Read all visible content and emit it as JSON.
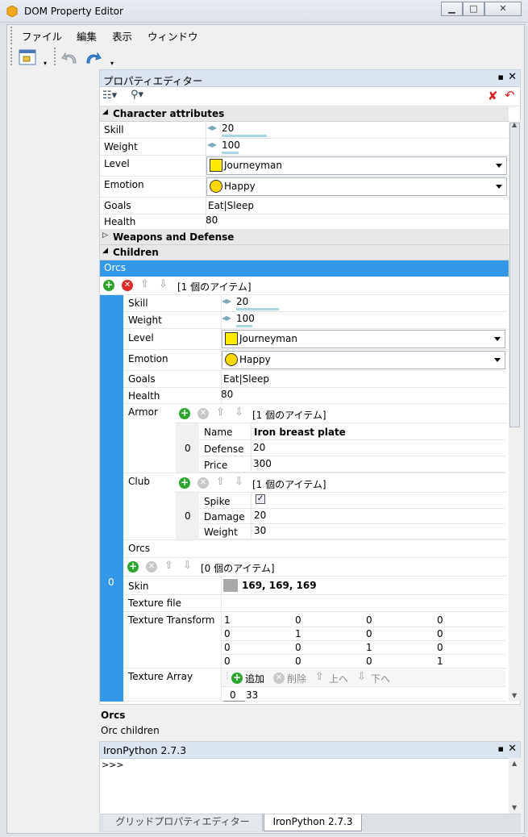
{
  "window": {
    "title": "DOM Property Editor",
    "minimize": "▁",
    "maximize": "□",
    "close": "✕"
  },
  "menu": [
    "ファイル",
    "編集",
    "表示",
    "ウィンドウ"
  ],
  "property_panel": {
    "title": "プロパティエディター",
    "pin_glyph": "📌",
    "close_glyph": "✕",
    "categories": {
      "character": "Character attributes",
      "weapons": "Weapons and Defense",
      "children": "Children"
    },
    "character": {
      "skill": {
        "label": "Skill",
        "value": "20"
      },
      "weight": {
        "label": "Weight",
        "value": "100"
      },
      "level": {
        "label": "Level",
        "value": "Journeyman"
      },
      "emotion": {
        "label": "Emotion",
        "value": "Happy"
      },
      "goals": {
        "label": "Goals",
        "value": "Eat|Sleep"
      },
      "health": {
        "label": "Health",
        "value": "80"
      }
    },
    "orcs_header": "Orcs",
    "orcs_count": "[1 個のアイテム]",
    "orc_index": "0",
    "orc": {
      "skill": {
        "label": "Skill",
        "value": "20"
      },
      "weight": {
        "label": "Weight",
        "value": "100"
      },
      "level": {
        "label": "Level",
        "value": "Journeyman"
      },
      "emotion": {
        "label": "Emotion",
        "value": "Happy"
      },
      "goals": {
        "label": "Goals",
        "value": "Eat|Sleep"
      },
      "health": {
        "label": "Health",
        "value": "80"
      },
      "armor": {
        "label": "Armor",
        "count": "[1 個のアイテム]",
        "index": "0",
        "name": {
          "label": "Name",
          "value": "Iron breast plate"
        },
        "defense": {
          "label": "Defense",
          "value": "20"
        },
        "price": {
          "label": "Price",
          "value": "300"
        }
      },
      "club": {
        "label": "Club",
        "count": "[1 個のアイテム]",
        "index": "0",
        "spike": {
          "label": "Spike",
          "checked": true
        },
        "damage": {
          "label": "Damage",
          "value": "20"
        },
        "weight": {
          "label": "Weight",
          "value": "30"
        }
      },
      "orcs": {
        "label": "Orcs",
        "count": "[0 個のアイテム]"
      },
      "skin": {
        "label": "Skin",
        "value": "169, 169, 169",
        "color": "#a9a9a9"
      },
      "texture_file": {
        "label": "Texture file",
        "value": ""
      },
      "texture_transform": {
        "label": "Texture Transform",
        "matrix": [
          [
            "1",
            "0",
            "0",
            "0"
          ],
          [
            "0",
            "1",
            "0",
            "0"
          ],
          [
            "0",
            "0",
            "1",
            "0"
          ],
          [
            "0",
            "0",
            "0",
            "1"
          ]
        ]
      },
      "texture_array": {
        "label": "Texture Array",
        "add": "追加",
        "delete": "削除",
        "up": "上へ",
        "down": "下へ",
        "index": "0",
        "value": "33"
      }
    }
  },
  "description": {
    "title": "Orcs",
    "text": "Orc children"
  },
  "python": {
    "title": "IronPython 2.7.3",
    "prompt": ">>>"
  },
  "tabs": [
    "グリッドプロパティエディター",
    "IronPython 2.7.3"
  ],
  "colors": {
    "accent": "#3399e6",
    "header": "#dbe5f1"
  }
}
